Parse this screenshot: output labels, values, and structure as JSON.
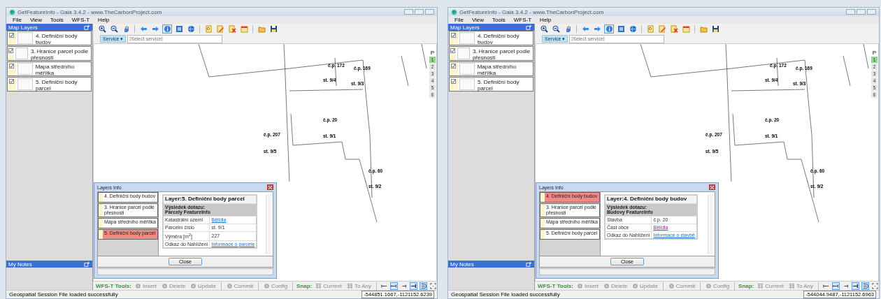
{
  "windows": [
    {
      "title": "GetFeatureInfo - Gaia 3.4.2 - www.TheCarbonProject.com",
      "menu": [
        "File",
        "View",
        "Tools",
        "WFS-T",
        "Help"
      ],
      "map_layers": {
        "title": "Map Layers",
        "items": [
          {
            "label": "4. Definiční body budov",
            "checked": true
          },
          {
            "label": "3. Hranice parcel podle přesnosti",
            "checked": true
          },
          {
            "label": "Mapa středního měřítka",
            "checked": true
          },
          {
            "label": "5. Definiční body parcel",
            "checked": true
          }
        ]
      },
      "notes_title": "My Notes",
      "tools": [
        {
          "selected": false
        },
        {
          "selected": false
        },
        {
          "selected": false
        },
        {
          "selected": false
        },
        {
          "selected": false
        },
        {
          "selected": true
        },
        {
          "selected": false
        },
        {
          "selected": false
        },
        {
          "selected": false
        },
        {
          "selected": false
        },
        {
          "selected": false
        },
        {
          "selected": false
        },
        {
          "selected": false
        },
        {
          "selected": false
        }
      ],
      "service": {
        "label": "Service ▾",
        "placeholder": "[Select service]"
      },
      "map_labels": [
        "č.p. 172",
        "č.p. 169",
        "st. 9/4",
        "st. 9/3",
        "č.p. 20",
        "st. 9/1",
        "č.p. 207",
        "st. 9/5",
        "č.p. 60",
        "st. 9/2"
      ],
      "pages": {
        "label": "P",
        "items": [
          {
            "label": "1",
            "selected": true
          },
          {
            "label": "2",
            "selected": false
          },
          {
            "label": "3",
            "selected": false
          },
          {
            "label": "4",
            "selected": false
          },
          {
            "label": "5",
            "selected": false
          },
          {
            "label": "6",
            "selected": false
          }
        ]
      },
      "dialog": {
        "title": "Layers Info",
        "layers": [
          {
            "label": "4. Definiční body budov",
            "selected": false
          },
          {
            "label": "3. Hranice parcel podle přesnosti",
            "selected": false
          },
          {
            "label": "Mapa středního měřítka",
            "selected": false
          },
          {
            "label": "5. Definiční body parcel",
            "selected": true
          }
        ],
        "heading": "Layer:5. Definiční body parcel",
        "result_title": "Výsledek dotazu:",
        "result_subtitle": "Parcely FeatureInfo",
        "rows": [
          {
            "name": "Katastrální území",
            "value": "Bělidla",
            "kind": "link"
          },
          {
            "name": "Parcelní číslo",
            "value": "st. 9/1",
            "kind": "text"
          },
          {
            "name": "Výměra [m$^{2}$]",
            "value": "227",
            "kind": "text"
          },
          {
            "name": "Odkaz do Nahlížení",
            "value": "Informace o parcele",
            "kind": "link"
          }
        ],
        "close": "Close"
      },
      "wfs": {
        "label": "WFS-T Tools:",
        "buttons": [
          {
            "label": "Insert",
            "disabled": true
          },
          {
            "label": "Delete",
            "disabled": true
          },
          {
            "label": "Update",
            "disabled": true
          },
          {
            "label": "Commit",
            "disabled": true
          },
          {
            "label": "Config",
            "disabled": true
          }
        ],
        "snap_label": "Snap:",
        "snap_buttons": [
          {
            "label": "Current",
            "disabled": true
          },
          {
            "label": "To Any",
            "disabled": true
          }
        ],
        "snap_tools": [
          {
            "selected": false
          },
          {
            "selected": true
          },
          {
            "selected": false
          },
          {
            "selected": true
          },
          {
            "selected": true
          },
          {
            "selected": false
          }
        ]
      },
      "status": "Geospatial Session File loaded successfully",
      "coordinates": "-544851.1667,-1121152.6239"
    },
    {
      "title": "GetFeatureInfo - Gaia 3.4.2 - www.TheCarbonProject.com",
      "menu": [
        "File",
        "View",
        "Tools",
        "WFS-T",
        "Help"
      ],
      "map_layers": {
        "title": "Map Layers",
        "items": [
          {
            "label": "4. Definiční body budov",
            "checked": true
          },
          {
            "label": "3. Hranice parcel podle přesnosti",
            "checked": true
          },
          {
            "label": "Mapa středního měřítka",
            "checked": true
          },
          {
            "label": "5. Definiční body parcel",
            "checked": true
          }
        ]
      },
      "notes_title": "My Notes",
      "tools": [
        {
          "selected": false
        },
        {
          "selected": false
        },
        {
          "selected": false
        },
        {
          "selected": false
        },
        {
          "selected": false
        },
        {
          "selected": true
        },
        {
          "selected": false
        },
        {
          "selected": false
        },
        {
          "selected": false
        },
        {
          "selected": false
        },
        {
          "selected": false
        },
        {
          "selected": false
        },
        {
          "selected": false
        },
        {
          "selected": false
        }
      ],
      "service": {
        "label": "Service ▾",
        "placeholder": "[Select service]"
      },
      "map_labels": [
        "č.p. 172",
        "č.p. 169",
        "st. 9/4",
        "st. 9/3",
        "č.p. 20",
        "st. 9/1",
        "č.p. 207",
        "st. 9/5",
        "č.p. 60",
        "st. 9/2"
      ],
      "pages": {
        "label": "P",
        "items": [
          {
            "label": "1",
            "selected": true
          },
          {
            "label": "2",
            "selected": false
          },
          {
            "label": "3",
            "selected": false
          },
          {
            "label": "4",
            "selected": false
          },
          {
            "label": "5",
            "selected": false
          },
          {
            "label": "6",
            "selected": false
          }
        ]
      },
      "dialog": {
        "title": "Layers Info",
        "layers": [
          {
            "label": "4. Definiční body budov",
            "selected": true
          },
          {
            "label": "3. Hranice parcel podle přesnosti",
            "selected": false
          },
          {
            "label": "Mapa středního měřítka",
            "selected": false
          },
          {
            "label": "5. Definiční body parcel",
            "selected": false
          }
        ],
        "heading": "Layer:4. Definiční body budov",
        "result_title": "Výsledek dotazu:",
        "result_subtitle": "Budovy FeatureInfo",
        "rows": [
          {
            "name": "Stavba",
            "value": "č.p. 20",
            "kind": "text"
          },
          {
            "name": "Část obce",
            "value": "Bělidla",
            "kind": "visited"
          },
          {
            "name": "Odkaz do Nahlížení",
            "value": "Informace o stavbě",
            "kind": "link"
          }
        ],
        "close": "Close"
      },
      "wfs": {
        "label": "WFS-T Tools:",
        "buttons": [
          {
            "label": "Insert",
            "disabled": true
          },
          {
            "label": "Delete",
            "disabled": true
          },
          {
            "label": "Update",
            "disabled": true
          },
          {
            "label": "Commit",
            "disabled": true
          },
          {
            "label": "Config",
            "disabled": true
          }
        ],
        "snap_label": "Snap:",
        "snap_buttons": [
          {
            "label": "Current",
            "disabled": true
          },
          {
            "label": "To Any",
            "disabled": true
          }
        ],
        "snap_tools": [
          {
            "selected": false
          },
          {
            "selected": true
          },
          {
            "selected": false
          },
          {
            "selected": true
          },
          {
            "selected": true
          },
          {
            "selected": false
          }
        ]
      },
      "status": "Geospatial Session File loaded successfully",
      "coordinates": "-544044.9487,-1121152.6963"
    }
  ]
}
